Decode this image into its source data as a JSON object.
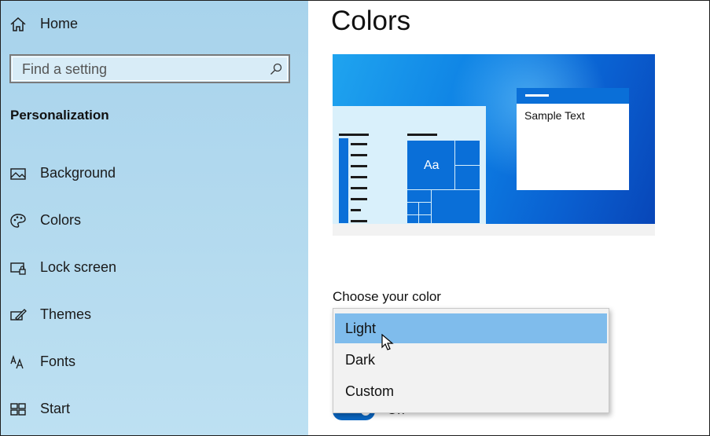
{
  "sidebar": {
    "home_label": "Home",
    "search_placeholder": "Find a setting",
    "section_title": "Personalization",
    "items": [
      {
        "label": "Background",
        "icon": "picture-icon"
      },
      {
        "label": "Colors",
        "icon": "palette-icon"
      },
      {
        "label": "Lock screen",
        "icon": "lock-screen-icon"
      },
      {
        "label": "Themes",
        "icon": "brush-icon"
      },
      {
        "label": "Fonts",
        "icon": "fonts-icon"
      },
      {
        "label": "Start",
        "icon": "start-grid-icon"
      }
    ]
  },
  "main": {
    "title": "Colors",
    "preview": {
      "sample_text": "Sample Text",
      "tile_text": "Aa"
    },
    "choose_color_label": "Choose your color",
    "dropdown": {
      "options": [
        "Light",
        "Dark",
        "Custom"
      ],
      "highlighted": "Light"
    },
    "toggle_label": "On"
  },
  "colors": {
    "accent": "#0a6fd8",
    "sidebar_bg": "#b5dbef",
    "highlight": "#7fbcec"
  }
}
